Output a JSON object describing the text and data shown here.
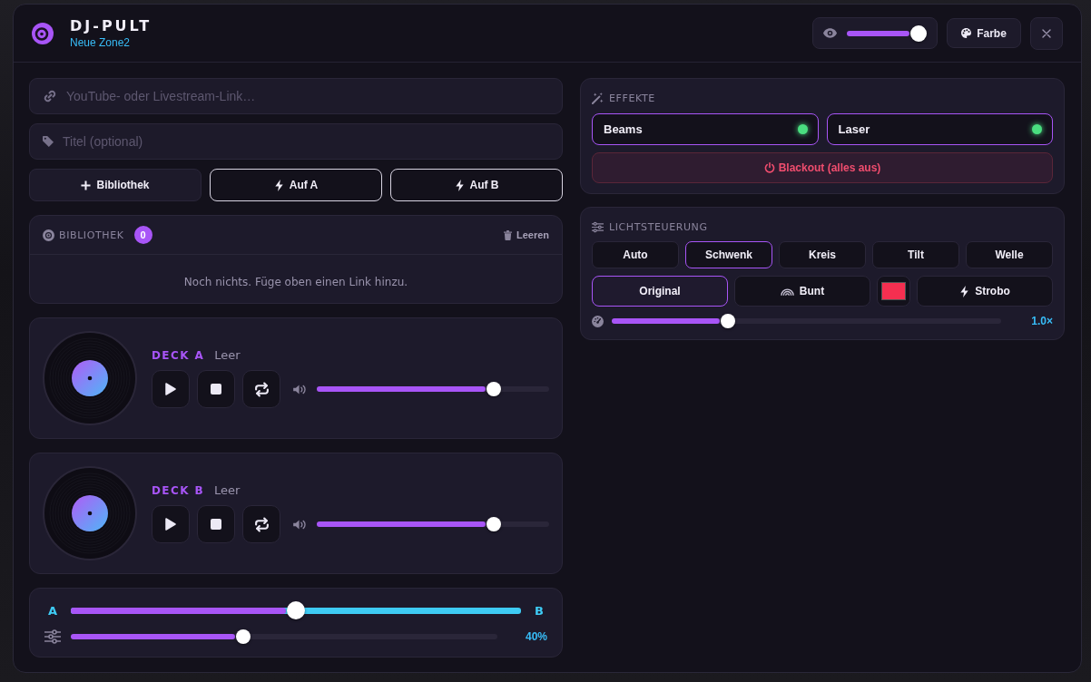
{
  "header": {
    "title": "DJ-PULT",
    "subtitle": "Neue Zone2",
    "opacity_slider": {
      "level": 1.0
    },
    "color_button": "Farbe"
  },
  "link_input": {
    "placeholder": "YouTube- oder Livestream-Link…"
  },
  "title_input": {
    "placeholder": "Titel (optional)"
  },
  "actions": [
    {
      "kind": "add",
      "label": "Bibliothek"
    },
    {
      "kind": "load",
      "label": "Auf A"
    },
    {
      "kind": "load",
      "label": "Auf B"
    }
  ],
  "library": {
    "title": "BIBLIOTHEK",
    "count": "0",
    "clear_button": "Leeren",
    "empty_text": "Noch nichts. Füge oben einen Link hinzu."
  },
  "decks": [
    {
      "name": "DECK A",
      "status": "Leer",
      "volume": {
        "level": 0.78
      }
    },
    {
      "name": "DECK B",
      "status": "Leer",
      "volume": {
        "level": 0.78
      }
    }
  ],
  "mixer": {
    "crossfader": {
      "left_label": "A",
      "right_label": "B",
      "level": 0.5
    },
    "master": {
      "level": 0.4,
      "reading": "40%"
    }
  },
  "effects": {
    "title": "EFFEKTE",
    "toggles": [
      {
        "label": "Beams",
        "on": true
      },
      {
        "label": "Laser",
        "on": true
      }
    ],
    "blackout_button": "Blackout (alles aus)"
  },
  "light_control": {
    "title": "LICHTSTEUERUNG",
    "modes": [
      {
        "label": "Auto",
        "selected": false
      },
      {
        "label": "Schwenk",
        "selected": true
      },
      {
        "label": "Kreis",
        "selected": false
      },
      {
        "label": "Tilt",
        "selected": false
      },
      {
        "label": "Welle",
        "selected": false
      }
    ],
    "color_modes": [
      {
        "kind": "original",
        "label": "Original",
        "selected": true
      },
      {
        "kind": "rainbow",
        "label": "Bunt",
        "selected": false
      }
    ],
    "custom_color": {
      "color": "#f52f50"
    },
    "strobe": {
      "label": "Strobo",
      "on": false
    },
    "speed": {
      "level": 0.29,
      "reading": "1.0×"
    }
  }
}
